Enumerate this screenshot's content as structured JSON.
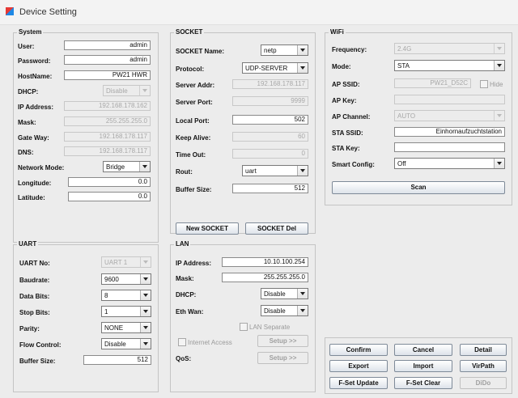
{
  "window": {
    "title": "Device Setting"
  },
  "system": {
    "label": "System",
    "user_label": "User:",
    "user": "admin",
    "password_label": "Password:",
    "password": "admin",
    "hostname_label": "HostName:",
    "hostname": "PW21 HWR",
    "dhcp_label": "DHCP:",
    "dhcp": "Disable",
    "ip_label": "IP Address:",
    "ip": "192.168.178.162",
    "mask_label": "Mask:",
    "mask": "255.255.255.0",
    "gateway_label": "Gate Way:",
    "gateway": "192.168.178.117",
    "dns_label": "DNS:",
    "dns": "192.168.178.117",
    "netmode_label": "Network Mode:",
    "netmode": "Bridge",
    "longitude_label": "Longitude:",
    "longitude": "0.0",
    "latitude_label": "Latitude:",
    "latitude": "0.0"
  },
  "socket": {
    "label": "SOCKET",
    "name_label": "SOCKET Name:",
    "name": "netp",
    "protocol_label": "Protocol:",
    "protocol": "UDP-SERVER",
    "server_addr_label": "Server Addr:",
    "server_addr": "192.168.178.117",
    "server_port_label": "Server Port:",
    "server_port": "9999",
    "local_port_label": "Local Port:",
    "local_port": "502",
    "keep_alive_label": "Keep Alive:",
    "keep_alive": "60",
    "timeout_label": "Time Out:",
    "timeout": "0",
    "rout_label": "Rout:",
    "rout": "uart",
    "buffer_label": "Buffer Size:",
    "buffer": "512",
    "new_button": "New SOCKET",
    "del_button": "SOCKET Del"
  },
  "wifi": {
    "label": "WiFi",
    "frequency_label": "Frequency:",
    "frequency": "2.4G",
    "mode_label": "Mode:",
    "mode": "STA",
    "ap_ssid_label": "AP SSID:",
    "ap_ssid": "PW21_D52C",
    "hide_label": "Hide",
    "ap_key_label": "AP Key:",
    "ap_key": "",
    "ap_channel_label": "AP Channel:",
    "ap_channel": "AUTO",
    "sta_ssid_label": "STA SSID:",
    "sta_ssid": "Einhornaufzuchtstation",
    "sta_key_label": "STA Key:",
    "sta_key": "",
    "smart_label": "Smart Config:",
    "smart": "Off",
    "scan_button": "Scan"
  },
  "uart": {
    "label": "UART",
    "no_label": "UART No:",
    "no": "UART 1",
    "baud_label": "Baudrate:",
    "baud": "9600",
    "databits_label": "Data Bits:",
    "databits": "8",
    "stopbits_label": "Stop Bits:",
    "stopbits": "1",
    "parity_label": "Parity:",
    "parity": "NONE",
    "flow_label": "Flow Control:",
    "flow": "Disable",
    "buffer_label": "Buffer Size:",
    "buffer": "512"
  },
  "lan": {
    "label": "LAN",
    "ip_label": "IP Address:",
    "ip": "10.10.100.254",
    "mask_label": "Mask:",
    "mask": "255.255.255.0",
    "dhcp_label": "DHCP:",
    "dhcp": "Disable",
    "ethwan_label": "Eth Wan:",
    "ethwan": "Disable",
    "lan_separate_label": "LAN Separate",
    "internet_access_label": "Internet Access",
    "qos_label": "QoS:",
    "setup_label": "Setup >>"
  },
  "actions": {
    "confirm": "Confirm",
    "cancel": "Cancel",
    "detail": "Detail",
    "export": "Export",
    "import": "Import",
    "virpath": "VirPath",
    "fset_update": "F-Set Update",
    "fset_clear": "F-Set Clear",
    "dido": "DiDo"
  }
}
